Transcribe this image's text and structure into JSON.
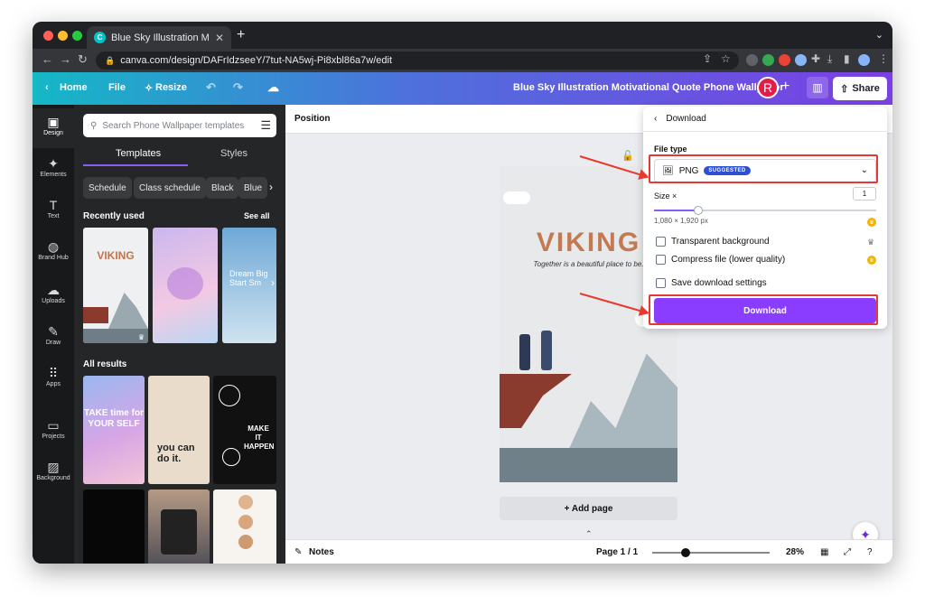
{
  "browser": {
    "tab_title": "Blue Sky Illustration Motivatio",
    "new_tab": "+",
    "url": "canva.com/design/DAFrIdzseeY/7tut-NA5wj-Pi8xbl86a7w/edit"
  },
  "header": {
    "home": "Home",
    "file": "File",
    "resize": "Resize",
    "doc_title": "Blue Sky Illustration Motivational Quote Phone Wallpaper",
    "avatar_initial": "R",
    "share": "Share"
  },
  "rail": {
    "items": [
      {
        "label": "Design",
        "icon": "▣"
      },
      {
        "label": "Elements",
        "icon": "✦"
      },
      {
        "label": "Text",
        "icon": "T"
      },
      {
        "label": "Brand Hub",
        "icon": "◍"
      },
      {
        "label": "Uploads",
        "icon": "☁"
      },
      {
        "label": "Draw",
        "icon": "✎"
      },
      {
        "label": "Apps",
        "icon": "⠿"
      },
      {
        "label": "Projects",
        "icon": "▭"
      },
      {
        "label": "Background",
        "icon": "▨"
      }
    ]
  },
  "panel": {
    "search_placeholder": "Search Phone Wallpaper templates",
    "tabs": [
      "Templates",
      "Styles"
    ],
    "chips": [
      "Schedule",
      "Class schedule",
      "Black",
      "Blue"
    ],
    "recently_used": "Recently used",
    "see_all": "See all",
    "all_results": "All results",
    "thumb_texts": {
      "viking": "VIKING",
      "dream": "Dream Big Start Sm",
      "take_time": "TAKE time for YOUR SELF",
      "you_can": "you can do it.",
      "make_it": "MAKE IT HAPPEN"
    }
  },
  "canvas": {
    "position_label": "Position",
    "add_page": "+ Add page",
    "design_title": "VIKING",
    "design_tagline": "Together is a beautiful place to be."
  },
  "bottom": {
    "notes": "Notes",
    "page": "Page 1 / 1",
    "zoom": "28%"
  },
  "download": {
    "title": "Download",
    "file_type_label": "File type",
    "file_type_value": "PNG",
    "suggested": "SUGGESTED",
    "size_label": "Size ×",
    "size_value": "1",
    "size_fraction": 0.2,
    "dims": "1,080 × 1,920 px",
    "transparent": "Transparent background",
    "compress": "Compress file (lower quality)",
    "save_settings": "Save download settings",
    "download_button": "Download"
  },
  "colors": {
    "accent_purple": "#8b3dff",
    "annotation_red": "#e53935",
    "suggested_badge": "#2d4fd6"
  }
}
